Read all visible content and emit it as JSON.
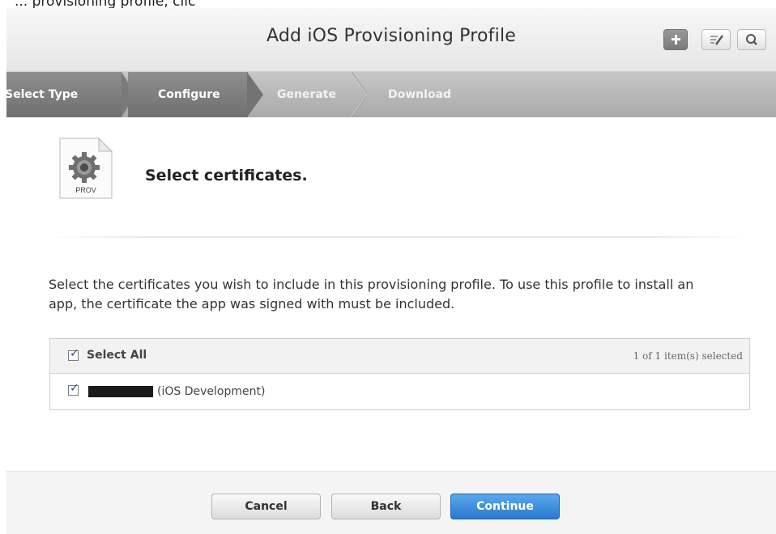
{
  "top_text": "     ...  provisioning profile, clic",
  "header": {
    "title": "Add iOS Provisioning Profile",
    "icons": [
      "plus-icon",
      "edit-icon",
      "search-icon"
    ]
  },
  "steps": [
    {
      "label": "Select Type",
      "state": "done"
    },
    {
      "label": "Configure",
      "state": "current"
    },
    {
      "label": "Generate",
      "state": "pending"
    },
    {
      "label": "Download",
      "state": "pending"
    }
  ],
  "section": {
    "icon_label": "PROV",
    "title": "Select certificates."
  },
  "description": "Select the certificates you wish to include in this provisioning profile. To use this profile to install an app, the certificate the app was signed with must be included.",
  "certificates": {
    "select_all_label": "Select All",
    "select_all_checked": true,
    "count_text": "1 of 1 item(s) selected",
    "items": [
      {
        "label": "(iOS Development)",
        "checked": true
      }
    ]
  },
  "footer": {
    "cancel": "Cancel",
    "back": "Back",
    "continue": "Continue"
  },
  "colors": {
    "accent": "#2a79cf",
    "step_active": "#707070"
  }
}
